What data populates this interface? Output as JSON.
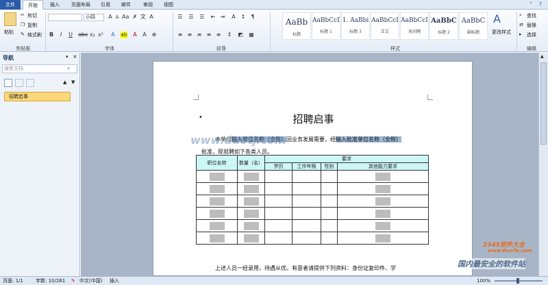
{
  "tabs": [
    "文件",
    "开始",
    "插入",
    "页面布局",
    "引用",
    "邮件",
    "审阅",
    "视图"
  ],
  "clipboard": {
    "paste": "粘贴",
    "cut": "剪切",
    "copy": "复制",
    "format_painter": "格式刷",
    "label": "剪贴板"
  },
  "font": {
    "size": "小四",
    "label": "字体"
  },
  "paragraph": {
    "label": "段落"
  },
  "styles": {
    "items": [
      {
        "sample": "AaBb",
        "name": "标题"
      },
      {
        "sample": "AaBbCcDc",
        "name": "标题 1"
      },
      {
        "sample": "1. AaBbi",
        "name": "标题 3"
      },
      {
        "sample": "AaBbCcI",
        "name": "正文"
      },
      {
        "sample": "AaBbCcI",
        "name": "无间隔"
      },
      {
        "sample": "AaBbC",
        "name": "标题 2"
      },
      {
        "sample": "AaBbC",
        "name": "副标题"
      }
    ],
    "change": "更改样式",
    "label": "样式"
  },
  "editing": {
    "find": "查找",
    "replace": "替换",
    "select": "选择",
    "label": "编辑"
  },
  "nav": {
    "title": "导航",
    "search_placeholder": "搜索文档",
    "item": "招聘启事"
  },
  "doc": {
    "title": "招聘启事",
    "p1_pre": "本单位",
    "p1_hl": "输入单位名称（全称）",
    "p1_mid": "因业务发展需要，经",
    "p1_hl2": "输入批准单位名称（全称）",
    "p2": "批准，现就聘如下各类人员。",
    "table": {
      "h_position": "职位名称",
      "h_count": "数量（名）",
      "h_req": "要求",
      "h_edu": "学历",
      "h_years": "工作年限",
      "h_gender": "性别",
      "h_other": "其他能力要求"
    },
    "footer": "上述人员一经录用，待遇从优。有意者请提供下列资料：身份证复印件、学"
  },
  "status": {
    "page": "页面: 1/1",
    "words": "字数: 10/261",
    "lang": "中文(中国)",
    "mode": "插入",
    "zoom": "100%"
  },
  "watermark": {
    "left": "www.duotj.com",
    "brand": "2345软件大全",
    "url": "www.DuoTe.com",
    "slogan": "国内最安全的软件站"
  }
}
